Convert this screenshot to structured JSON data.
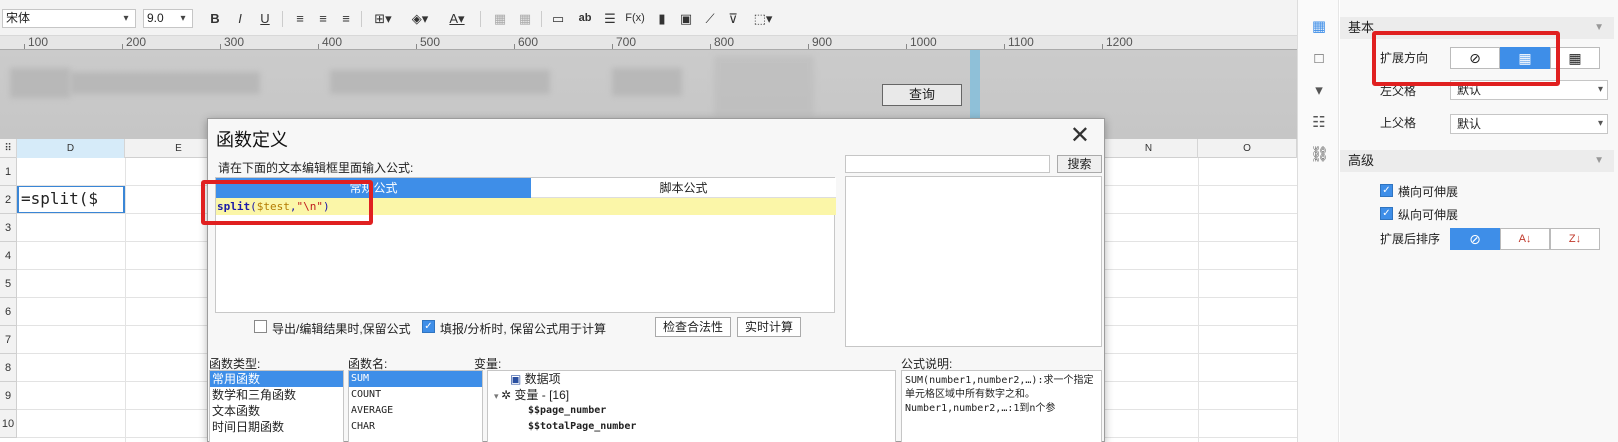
{
  "toolbar": {
    "font_name": "宋体",
    "font_size": "9.0",
    "bold": "B",
    "italic": "I",
    "underline": "U",
    "abc_label": "ab",
    "fx_label": "F(x)"
  },
  "ruler": {
    "labels": [
      "100",
      "200",
      "300",
      "400",
      "500",
      "600",
      "700",
      "800",
      "900",
      "1000",
      "1100",
      "1200"
    ]
  },
  "designer": {
    "query_button": "查询"
  },
  "grid": {
    "columns": [
      "D",
      "E",
      "N",
      "O"
    ],
    "rows": [
      "1",
      "2",
      "3",
      "4",
      "5",
      "6",
      "7",
      "8",
      "9",
      "10"
    ],
    "active_cell_value": "=split($"
  },
  "dialog": {
    "title": "函数定义",
    "close": "✕",
    "hint": "请在下面的文本编辑框里面输入公式:",
    "search_button": "搜索",
    "tabs": {
      "normal": "常规公式",
      "script": "脚本公式"
    },
    "formula": {
      "fn": "split",
      "open": "(",
      "var": "$test",
      "comma": ",",
      "str": "\"\\n\"",
      "close": ")"
    },
    "checkbox_export": "导出/编辑结果时,保留公式",
    "checkbox_fill": "填报/分析时, 保留公式用于计算",
    "check_button": "检查合法性",
    "realtime_button": "实时计算",
    "section_types": "函数类型:",
    "section_names": "函数名:",
    "section_vars": "变量:",
    "section_desc": "公式说明:",
    "function_types": [
      "常用函数",
      "数学和三角函数",
      "文本函数",
      "时间日期函数"
    ],
    "function_names": [
      "SUM",
      "COUNT",
      "AVERAGE",
      "CHAR"
    ],
    "variables": {
      "data_item": "数据项",
      "var_group": "变量 - [16]",
      "var1": "$$page_number",
      "var2": "$$totalPage_number"
    },
    "description": "SUM(number1,number2,…):求一个指定单元格区域中所有数字之和。Number1,number2,…:1到n个参"
  },
  "props": {
    "basic": "基本",
    "expand_dir": "扩展方向",
    "left_parent": "左父格",
    "left_parent_value": "默认",
    "top_parent": "上父格",
    "top_parent_value": "默认",
    "advanced": "高级",
    "h_expand": "横向可伸展",
    "v_expand": "纵向可伸展",
    "sort_after": "扩展后排序"
  },
  "colors": {
    "accent": "#3e8ee8",
    "highlight": "#e02020",
    "formula_bg": "#fbf6a8"
  }
}
